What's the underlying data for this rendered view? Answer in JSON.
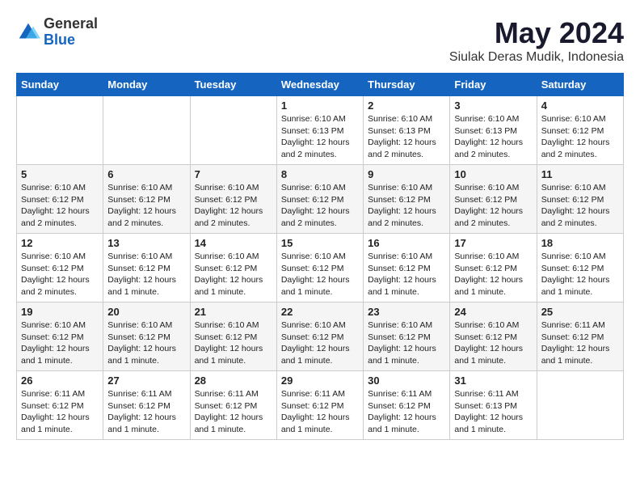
{
  "logo": {
    "general": "General",
    "blue": "Blue"
  },
  "title": "May 2024",
  "subtitle": "Siulak Deras Mudik, Indonesia",
  "header_color": "#1565c0",
  "days_of_week": [
    "Sunday",
    "Monday",
    "Tuesday",
    "Wednesday",
    "Thursday",
    "Friday",
    "Saturday"
  ],
  "weeks": [
    [
      {
        "day": "",
        "info": ""
      },
      {
        "day": "",
        "info": ""
      },
      {
        "day": "",
        "info": ""
      },
      {
        "day": "1",
        "info": "Sunrise: 6:10 AM\nSunset: 6:13 PM\nDaylight: 12 hours and 2 minutes."
      },
      {
        "day": "2",
        "info": "Sunrise: 6:10 AM\nSunset: 6:13 PM\nDaylight: 12 hours and 2 minutes."
      },
      {
        "day": "3",
        "info": "Sunrise: 6:10 AM\nSunset: 6:13 PM\nDaylight: 12 hours and 2 minutes."
      },
      {
        "day": "4",
        "info": "Sunrise: 6:10 AM\nSunset: 6:12 PM\nDaylight: 12 hours and 2 minutes."
      }
    ],
    [
      {
        "day": "5",
        "info": "Sunrise: 6:10 AM\nSunset: 6:12 PM\nDaylight: 12 hours and 2 minutes."
      },
      {
        "day": "6",
        "info": "Sunrise: 6:10 AM\nSunset: 6:12 PM\nDaylight: 12 hours and 2 minutes."
      },
      {
        "day": "7",
        "info": "Sunrise: 6:10 AM\nSunset: 6:12 PM\nDaylight: 12 hours and 2 minutes."
      },
      {
        "day": "8",
        "info": "Sunrise: 6:10 AM\nSunset: 6:12 PM\nDaylight: 12 hours and 2 minutes."
      },
      {
        "day": "9",
        "info": "Sunrise: 6:10 AM\nSunset: 6:12 PM\nDaylight: 12 hours and 2 minutes."
      },
      {
        "day": "10",
        "info": "Sunrise: 6:10 AM\nSunset: 6:12 PM\nDaylight: 12 hours and 2 minutes."
      },
      {
        "day": "11",
        "info": "Sunrise: 6:10 AM\nSunset: 6:12 PM\nDaylight: 12 hours and 2 minutes."
      }
    ],
    [
      {
        "day": "12",
        "info": "Sunrise: 6:10 AM\nSunset: 6:12 PM\nDaylight: 12 hours and 2 minutes."
      },
      {
        "day": "13",
        "info": "Sunrise: 6:10 AM\nSunset: 6:12 PM\nDaylight: 12 hours and 1 minute."
      },
      {
        "day": "14",
        "info": "Sunrise: 6:10 AM\nSunset: 6:12 PM\nDaylight: 12 hours and 1 minute."
      },
      {
        "day": "15",
        "info": "Sunrise: 6:10 AM\nSunset: 6:12 PM\nDaylight: 12 hours and 1 minute."
      },
      {
        "day": "16",
        "info": "Sunrise: 6:10 AM\nSunset: 6:12 PM\nDaylight: 12 hours and 1 minute."
      },
      {
        "day": "17",
        "info": "Sunrise: 6:10 AM\nSunset: 6:12 PM\nDaylight: 12 hours and 1 minute."
      },
      {
        "day": "18",
        "info": "Sunrise: 6:10 AM\nSunset: 6:12 PM\nDaylight: 12 hours and 1 minute."
      }
    ],
    [
      {
        "day": "19",
        "info": "Sunrise: 6:10 AM\nSunset: 6:12 PM\nDaylight: 12 hours and 1 minute."
      },
      {
        "day": "20",
        "info": "Sunrise: 6:10 AM\nSunset: 6:12 PM\nDaylight: 12 hours and 1 minute."
      },
      {
        "day": "21",
        "info": "Sunrise: 6:10 AM\nSunset: 6:12 PM\nDaylight: 12 hours and 1 minute."
      },
      {
        "day": "22",
        "info": "Sunrise: 6:10 AM\nSunset: 6:12 PM\nDaylight: 12 hours and 1 minute."
      },
      {
        "day": "23",
        "info": "Sunrise: 6:10 AM\nSunset: 6:12 PM\nDaylight: 12 hours and 1 minute."
      },
      {
        "day": "24",
        "info": "Sunrise: 6:10 AM\nSunset: 6:12 PM\nDaylight: 12 hours and 1 minute."
      },
      {
        "day": "25",
        "info": "Sunrise: 6:11 AM\nSunset: 6:12 PM\nDaylight: 12 hours and 1 minute."
      }
    ],
    [
      {
        "day": "26",
        "info": "Sunrise: 6:11 AM\nSunset: 6:12 PM\nDaylight: 12 hours and 1 minute."
      },
      {
        "day": "27",
        "info": "Sunrise: 6:11 AM\nSunset: 6:12 PM\nDaylight: 12 hours and 1 minute."
      },
      {
        "day": "28",
        "info": "Sunrise: 6:11 AM\nSunset: 6:12 PM\nDaylight: 12 hours and 1 minute."
      },
      {
        "day": "29",
        "info": "Sunrise: 6:11 AM\nSunset: 6:12 PM\nDaylight: 12 hours and 1 minute."
      },
      {
        "day": "30",
        "info": "Sunrise: 6:11 AM\nSunset: 6:12 PM\nDaylight: 12 hours and 1 minute."
      },
      {
        "day": "31",
        "info": "Sunrise: 6:11 AM\nSunset: 6:13 PM\nDaylight: 12 hours and 1 minute."
      },
      {
        "day": "",
        "info": ""
      }
    ]
  ]
}
